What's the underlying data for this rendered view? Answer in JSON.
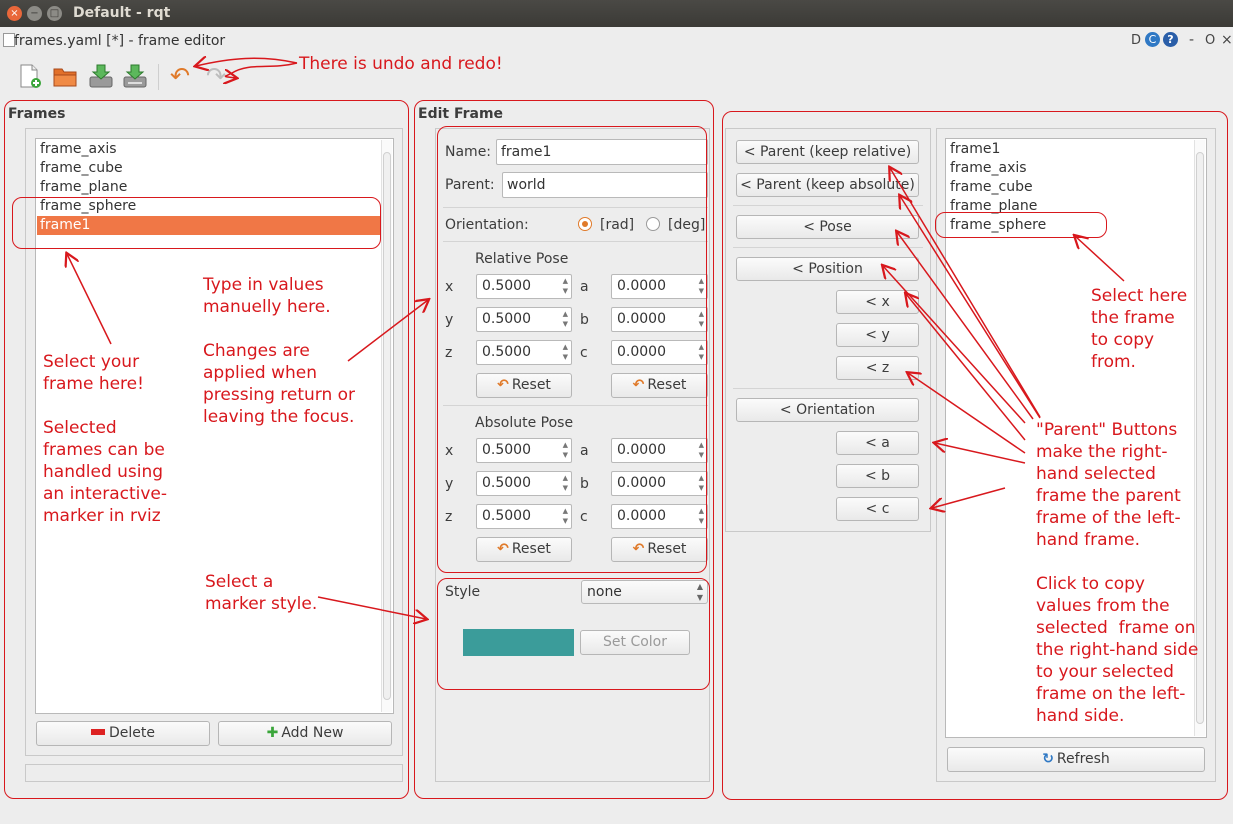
{
  "window": {
    "title": "Default - rqt",
    "close_glyph": "×",
    "min_glyph": "−",
    "max_glyph": "□"
  },
  "plugin": {
    "title": "frames.yaml [*] - frame editor",
    "header_d": "D",
    "header_refresh_glyph": "C",
    "header_help_glyph": "?",
    "header_dash": "-",
    "header_o": "O",
    "header_x": "×"
  },
  "toolbar": {
    "undo_glyph": "↶",
    "redo_glyph": "↷"
  },
  "frames": {
    "label": "Frames",
    "items": [
      "frame_axis",
      "frame_cube",
      "frame_plane",
      "frame_sphere",
      "frame1"
    ],
    "selected": "frame1",
    "delete_label": "Delete",
    "add_new_label": "Add New"
  },
  "edit": {
    "label": "Edit Frame",
    "name_label": "Name:",
    "name_value": "frame1",
    "parent_label": "Parent:",
    "parent_value": "world",
    "orientation_label": "Orientation:",
    "rad_label": "[rad]",
    "deg_label": "[deg]",
    "orientation_selected": "rad",
    "relative": {
      "title": "Relative Pose",
      "x_label": "x",
      "y_label": "y",
      "z_label": "z",
      "a_label": "a",
      "b_label": "b",
      "c_label": "c",
      "x": "0.5000",
      "y": "0.5000",
      "z": "0.5000",
      "a": "0.0000",
      "b": "0.0000",
      "c": "0.0000",
      "reset_label": "Reset"
    },
    "absolute": {
      "title": "Absolute Pose",
      "x_label": "x",
      "y_label": "y",
      "z_label": "z",
      "a_label": "a",
      "b_label": "b",
      "c_label": "c",
      "x": "0.5000",
      "y": "0.5000",
      "z": "0.5000",
      "a": "0.0000",
      "b": "0.0000",
      "c": "0.0000",
      "reset_label": "Reset"
    },
    "style_label": "Style",
    "style_value": "none",
    "set_color_label": "Set Color",
    "color": "#3b9c9a"
  },
  "copy_buttons": {
    "parent_keep_relative": "< Parent (keep relative)",
    "parent_keep_absolute": "< Parent (keep absolute)",
    "pose": "< Pose",
    "position": "< Position",
    "x": "< x",
    "y": "< y",
    "z": "< z",
    "orientation": "< Orientation",
    "a": "< a",
    "b": "< b",
    "c": "< c"
  },
  "right_frames": {
    "items": [
      "frame1",
      "frame_axis",
      "frame_cube",
      "frame_plane",
      "frame_sphere"
    ],
    "refresh_label": "Refresh"
  },
  "annotations": {
    "undo_redo": "There is undo and redo!",
    "select_frame": "Select your\nframe here!\n\nSelected\nframes can be\nhandled using\nan interactive-\nmarker in rviz",
    "type_values": "Type in values\nmanuelly here.\n\nChanges are\napplied when\npressing return or\nleaving the focus.",
    "marker_style": "Select a\nmarker style.",
    "select_copy": "Select here\nthe frame\nto copy\nfrom.",
    "parent_buttons": "\"Parent\" Buttons\nmake the right-\nhand selected\nframe the parent\nframe of the left-\nhand frame.\n\nClick to copy\nvalues from the\nselected  frame on\nthe right-hand side\nto your selected\nframe on the left-\nhand side.",
    "color": "#d8181d"
  }
}
